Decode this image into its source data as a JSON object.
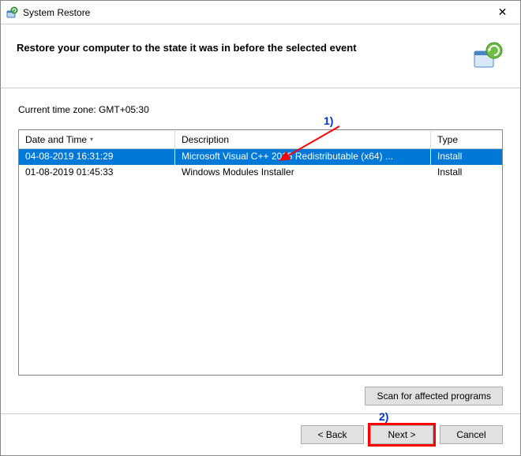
{
  "window": {
    "title": "System Restore",
    "close_label": "✕"
  },
  "banner": {
    "heading": "Restore your computer to the state it was in before the selected event"
  },
  "content": {
    "timezone_label": "Current time zone: GMT+05:30",
    "columns": {
      "date": "Date and Time",
      "desc": "Description",
      "type": "Type"
    },
    "rows": [
      {
        "date": "04-08-2019 16:31:29",
        "desc": "Microsoft Visual C++ 2015 Redistributable (x64) ...",
        "type": "Install",
        "selected": true
      },
      {
        "date": "01-08-2019 01:45:33",
        "desc": "Windows Modules Installer",
        "type": "Install",
        "selected": false
      }
    ],
    "scan_label": "Scan for affected programs"
  },
  "buttons": {
    "back": "< Back",
    "next": "Next >",
    "cancel": "Cancel"
  },
  "annotations": {
    "a1": "1)",
    "a2": "2)"
  }
}
